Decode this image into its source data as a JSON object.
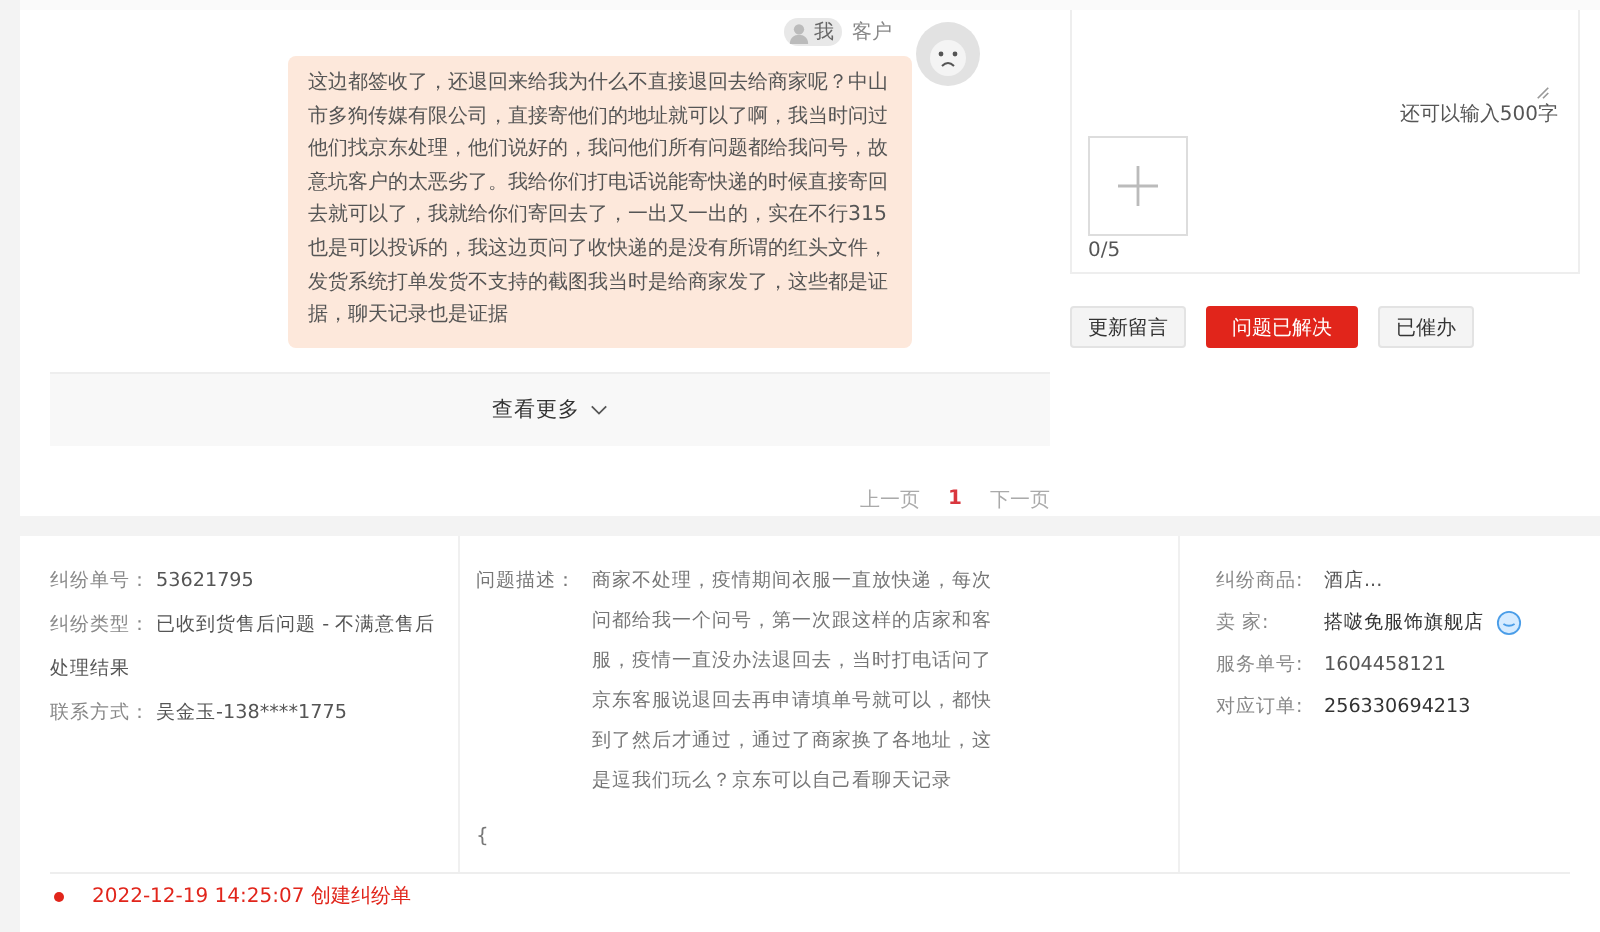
{
  "chat": {
    "messages": [
      {
        "sender_badge": "我",
        "sender_label": "客户",
        "text": "这边都签收了，还退回来给我为什么不直接退回去给商家呢？中山市多狗传媒有限公司，直接寄他们的地址就可以了啊，我当时问过他们找京东处理，他们说好的，我问他们所有问题都给我问号，故意坑客户的太恶劣了。我给你们打电话说能寄快递的时候直接寄回去就可以了，我就给你们寄回去了，一出又一出的，实在不行315也是可以投诉的，我这边页问了收快递的是没有所谓的红头文件，发货系统打单发货不支持的截图我当时是给商家发了，这些都是证据，聊天记录也是证据"
      }
    ],
    "more_button": "查看更多"
  },
  "pagination": {
    "prev": "上一页",
    "pages": [
      {
        "label": "1",
        "selected": true
      }
    ],
    "next": "下一页"
  },
  "reply_form": {
    "counter": "还可以输入500字",
    "upload_count": "0/5",
    "buttons": [
      {
        "label": "更新留言",
        "kind": "default"
      },
      {
        "label": "问题已解决",
        "kind": "primary"
      },
      {
        "label": "已催办",
        "kind": "default"
      }
    ]
  },
  "details": {
    "left": [
      {
        "label": "纠纷单号：",
        "value": "53621795"
      },
      {
        "label": "纠纷类型：",
        "value": "已收到货售后问题 - 不满意售后处理结果"
      },
      {
        "label": "联系方式：",
        "value": "吴金玉-138****1775"
      }
    ],
    "description": {
      "label": "问题描述：",
      "text": "商家不处理，疫情期间衣服一直放快递，每次问都给我一个问号，第一次跟这样的店家和客服，疫情一直没办法退回去，当时打电话问了京东客服说退回去再申请填单号就可以，都快到了然后才通过，通过了商家换了各地址，这是逗我们玩么？京东可以自己看聊天记录",
      "extra": "{"
    },
    "right": [
      {
        "label": "纠纷商品:",
        "value": "酒店...",
        "kind": "plain"
      },
      {
        "label": "卖 家:",
        "value": "搭啵免服饰旗舰店",
        "kind": "contact"
      },
      {
        "label": "服务单号:",
        "value": "1604458121",
        "kind": "plain"
      },
      {
        "label": "对应订单:",
        "value": "256330694213",
        "kind": "strong"
      }
    ]
  },
  "timeline": [
    {
      "text": "2022-12-19 14:25:07 创建纠纷单"
    }
  ]
}
